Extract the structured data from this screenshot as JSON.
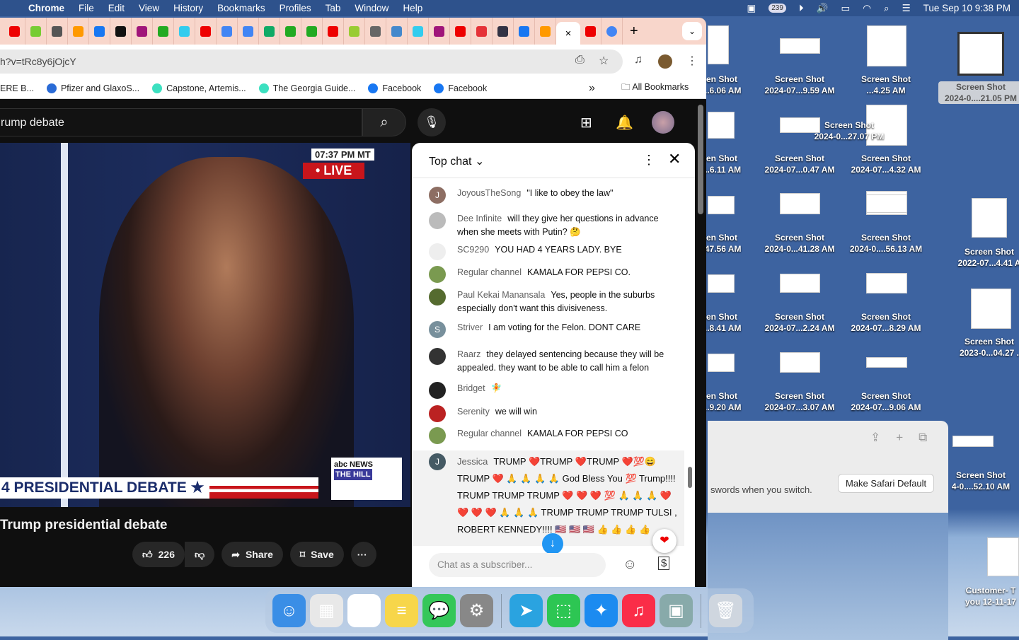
{
  "menubar": {
    "app": "Chrome",
    "items": [
      "File",
      "Edit",
      "View",
      "History",
      "Bookmarks",
      "Profiles",
      "Tab",
      "Window",
      "Help"
    ],
    "notification_count": "239",
    "datetime": "Tue Sep 10  9:38 PM"
  },
  "browser": {
    "url": "h?v=tRc8y6jOjcY",
    "tab_close": "×",
    "new_tab": "+",
    "tab_list": "⌄",
    "tab_favicons": [
      "#e00",
      "#7c3",
      "#555",
      "#f90",
      "#1877f2",
      "#111",
      "#a0157a",
      "#2a2",
      "#3ce",
      "#e00",
      "#4285f4",
      "#4285f4",
      "#1a6",
      "#2a2",
      "#2a2",
      "#e00",
      "#9c3",
      "#666",
      "#48c",
      "#3ce",
      "#a0157a",
      "#e00",
      "#e53238",
      "#334",
      "#1877f2",
      "#f90",
      "#e00"
    ],
    "bookmarks": [
      {
        "label": "ERE B...",
        "color": "#fff"
      },
      {
        "label": "Pfizer and GlaxoS...",
        "color": "#2a6bd6"
      },
      {
        "label": "Capstone, Artemis...",
        "color": "#3ce0c0"
      },
      {
        "label": "The Georgia Guide...",
        "color": "#3ce0c0"
      },
      {
        "label": "Facebook",
        "color": "#1877f2"
      },
      {
        "label": "Facebook",
        "color": "#1877f2"
      }
    ],
    "bookmarks_more": "»",
    "all_bookmarks": "All Bookmarks"
  },
  "youtube": {
    "search_value": "rump debate",
    "video": {
      "clock": "07:37 PM MT",
      "live": "• LIVE",
      "banner": "4 PRESIDENTIAL DEBATE ★",
      "logo1": "abc NEWS",
      "logo2": "THE HILL"
    },
    "title": "Trump presidential debate",
    "likes": "226",
    "share": "Share",
    "save": "Save",
    "more": "···"
  },
  "chat": {
    "header": "Top chat",
    "input_placeholder": "Chat as a subscriber...",
    "messages": [
      {
        "author": "JoyousTheSong",
        "text": "\"I like to obey the law\"",
        "avatar": "J",
        "color": "#8d6e63"
      },
      {
        "author": "Dee Infinite",
        "text": "will they give her questions in advance when she meets with Putin? 🤔",
        "avatar": "",
        "color": "#bbb"
      },
      {
        "author": "SC9290",
        "text": "YOU HAD 4 YEARS LADY. BYE",
        "avatar": "",
        "color": "#eee"
      },
      {
        "author": "Regular channel",
        "text": "KAMALA FOR PEPSI CO.",
        "avatar": "",
        "color": "#7a9a50"
      },
      {
        "author": "Paul Kekai Manansala",
        "text": "Yes, people in the suburbs especially don't want this divisiveness.",
        "avatar": "",
        "color": "#556b2f"
      },
      {
        "author": "Striver",
        "text": "I am voting for the Felon. DONT CARE",
        "avatar": "S",
        "color": "#78909c"
      },
      {
        "author": "Raarz",
        "text": "they delayed sentencing because they will be appealed. they want to be able to call him a felon",
        "avatar": "",
        "color": "#333"
      },
      {
        "author": "Bridget",
        "text": "🧚",
        "avatar": "",
        "color": "#222"
      },
      {
        "author": "Serenity",
        "text": "we will win",
        "avatar": "",
        "color": "#b22"
      },
      {
        "author": "Regular channel",
        "text": "KAMALA FOR PEPSI CO",
        "avatar": "",
        "color": "#7a9a50"
      },
      {
        "author": "Jessica",
        "text": "TRUMP ❤️TRUMP ❤️TRUMP ❤️💯😄 TRUMP ❤️ 🙏 🙏 🙏 🙏 God Bless You 💯 Trump!!!! TRUMP TRUMP TRUMP ❤️ ❤️ ❤️ 💯 🙏 🙏 🙏 ❤️ ❤️ ❤️ ❤️ 🙏 🙏 🙏 TRUMP TRUMP TRUMP TULSI , ROBERT KENNEDY!!!! 🇺🇸 🇺🇸 🇺🇸 👍 👍 👍 👍",
        "avatar": "J",
        "color": "#455a64"
      }
    ]
  },
  "safari_dialog": {
    "text": "swords when you switch.",
    "button": "Make Safari Default"
  },
  "desktop": {
    "icons": [
      {
        "title": "en Shot",
        "sub": "...6.06 AM"
      },
      {
        "title": "Screen Shot",
        "sub": "2024-07...9.59 AM"
      },
      {
        "title": "Screen Shot",
        "sub": "...4.25 AM"
      },
      {
        "title": "Screen Shot",
        "sub": "2024-0....21.05 PM"
      },
      {
        "title": "Screen Shot",
        "sub": "2024-0...27.07 PM"
      },
      {
        "title": "en Shot",
        "sub": "...6.11 AM"
      },
      {
        "title": "Screen Shot",
        "sub": "2024-07...0.47 AM"
      },
      {
        "title": "Screen Shot",
        "sub": "2024-07...4.32 AM"
      },
      {
        "title": "en Shot",
        "sub": ".47.56 AM"
      },
      {
        "title": "Screen Shot",
        "sub": "2024-0...41.28 AM"
      },
      {
        "title": "Screen Shot",
        "sub": "2024-0....56.13 AM"
      },
      {
        "title": "Screen Shot",
        "sub": "2022-07...4.41 A"
      },
      {
        "title": "en Shot",
        "sub": "...8.41 AM"
      },
      {
        "title": "Screen Shot",
        "sub": "2024-07...2.24 AM"
      },
      {
        "title": "Screen Shot",
        "sub": "2024-07...8.29 AM"
      },
      {
        "title": "Screen Shot",
        "sub": "2023-0...04.27 ."
      },
      {
        "title": "en Shot",
        "sub": "...9.20 AM"
      },
      {
        "title": "Screen Shot",
        "sub": "2024-07...3.07 AM"
      },
      {
        "title": "Screen Shot",
        "sub": "2024-07...9.06 AM"
      },
      {
        "title": "Screen Shot",
        "sub": "4-0....52.10 AM"
      },
      {
        "title": "Customer- T",
        "sub": "you 12-11-17"
      }
    ]
  },
  "dock": [
    {
      "name": "finder",
      "icon": "☺",
      "color": "#3a8ee6"
    },
    {
      "name": "launchpad",
      "icon": "▦",
      "color": "#e8e8e8"
    },
    {
      "name": "chrome",
      "icon": "◉",
      "color": "#fff"
    },
    {
      "name": "notes",
      "icon": "≡",
      "color": "#f7d64a"
    },
    {
      "name": "messages",
      "icon": "💬",
      "color": "#34c759"
    },
    {
      "name": "system-settings",
      "icon": "⚙",
      "color": "#888"
    },
    {
      "name": "telegram",
      "icon": "➤",
      "color": "#2aa3e0"
    },
    {
      "name": "facetime",
      "icon": "⬚",
      "color": "#2dc653"
    },
    {
      "name": "safari",
      "icon": "✦",
      "color": "#1c8bf0"
    },
    {
      "name": "music",
      "icon": "♫",
      "color": "#fa2d48"
    },
    {
      "name": "preview",
      "icon": "▣",
      "color": "#8aa"
    },
    {
      "name": "trash",
      "icon": "🗑",
      "color": "#cfd6df"
    }
  ]
}
